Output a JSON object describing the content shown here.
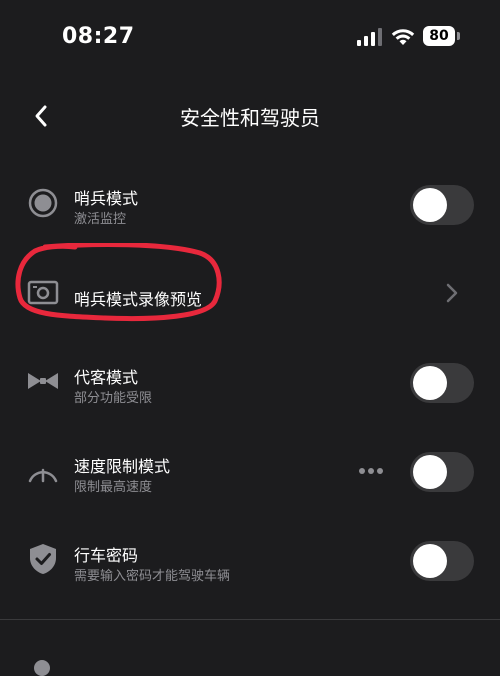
{
  "status_bar": {
    "time": "08:27",
    "battery": "80",
    "icons": [
      "signal-icon",
      "wifi-icon",
      "battery-icon"
    ]
  },
  "header": {
    "title": "安全性和驾驶员",
    "back_icon": "chevron-left-icon"
  },
  "rows": [
    {
      "icon": "sentry-dot-icon",
      "title": "哨兵模式",
      "subtitle": "激活监控",
      "control": "toggle",
      "enabled": false
    },
    {
      "icon": "camera-icon",
      "title": "哨兵模式录像预览",
      "subtitle": "",
      "control": "chevron",
      "highlighted": true
    },
    {
      "icon": "bowtie-icon",
      "title": "代客模式",
      "subtitle": "部分功能受限",
      "control": "toggle",
      "enabled": false
    },
    {
      "icon": "speedometer-icon",
      "title": "速度限制模式",
      "subtitle": "限制最高速度",
      "control": "toggle",
      "enabled": false,
      "has_more": true
    },
    {
      "icon": "shield-check-icon",
      "title": "行车密码",
      "subtitle": "需要输入密码才能驾驶车辆",
      "control": "toggle",
      "enabled": false
    }
  ],
  "colors": {
    "background": "#1c1c1e",
    "toggle_off": "#3a3a3c",
    "secondary_text": "#8e8e93",
    "highlight_annotation": "#e8283c"
  }
}
